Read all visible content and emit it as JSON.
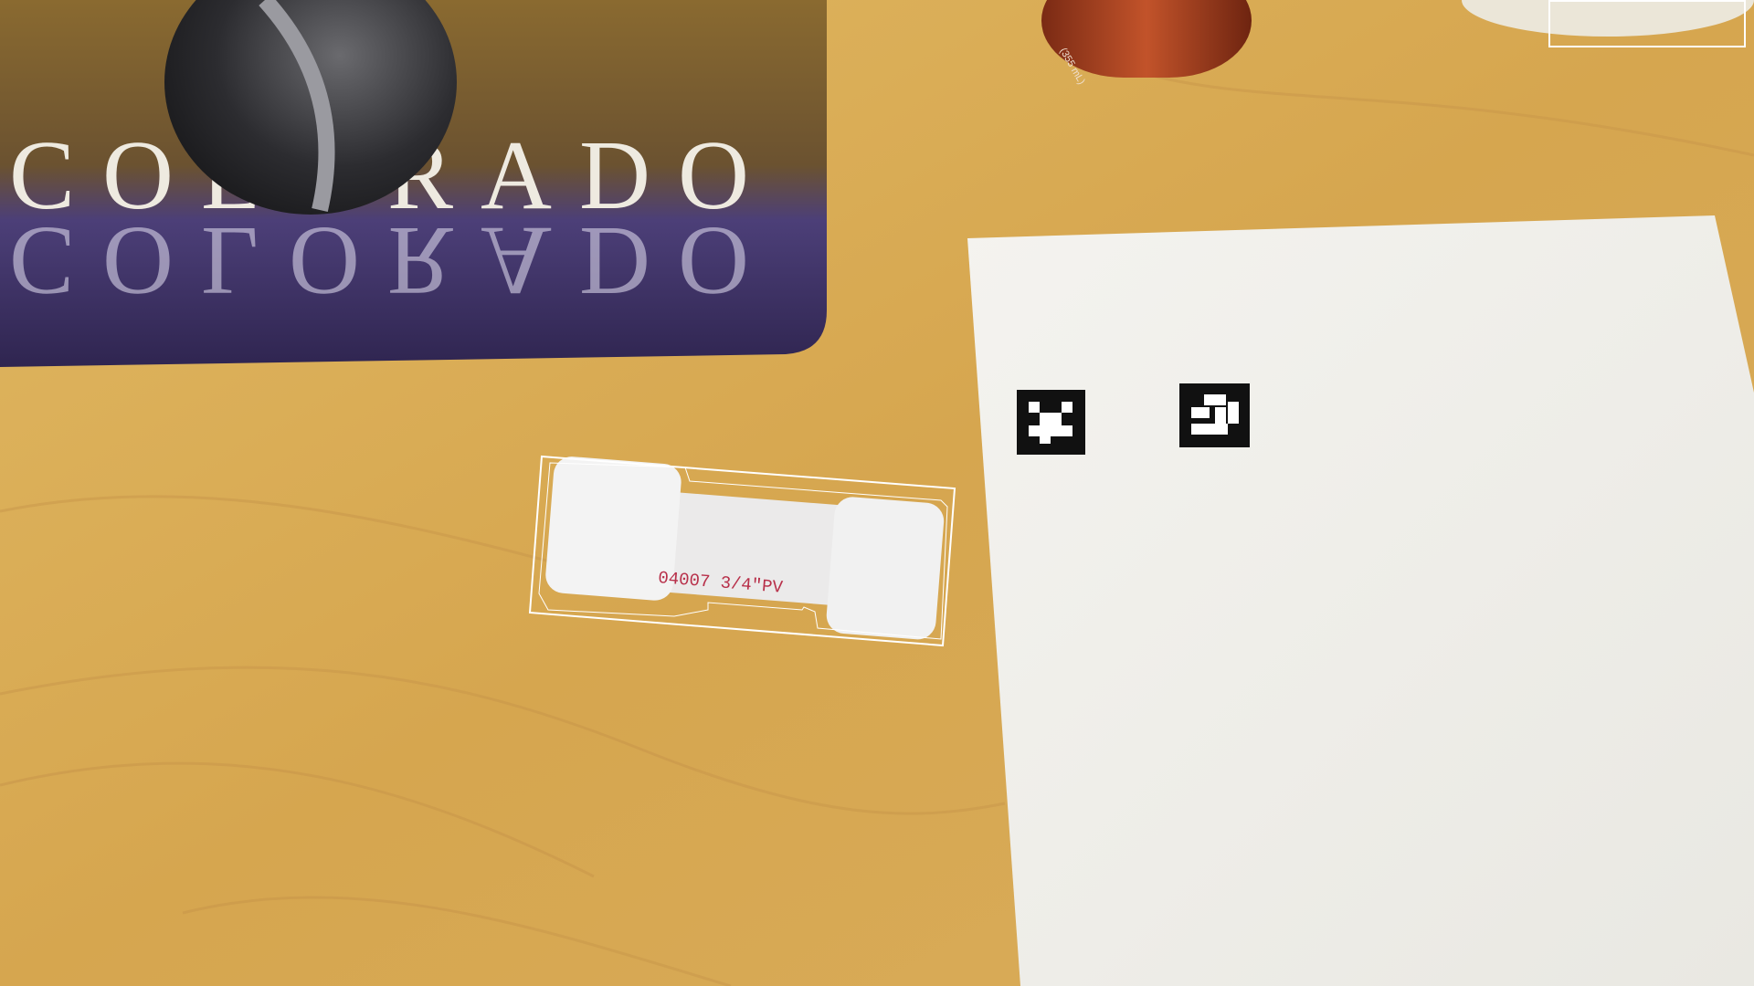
{
  "scene": {
    "mousepad_text": "COLORADO",
    "pipe_label": "04007 3/4\"PV",
    "can_label": "(355 mL)"
  },
  "colors": {
    "table": "#d9ab55",
    "paper": "#f2f1ec",
    "mousepad_water": "#4a3a8a",
    "overlay": "#ffffff"
  }
}
